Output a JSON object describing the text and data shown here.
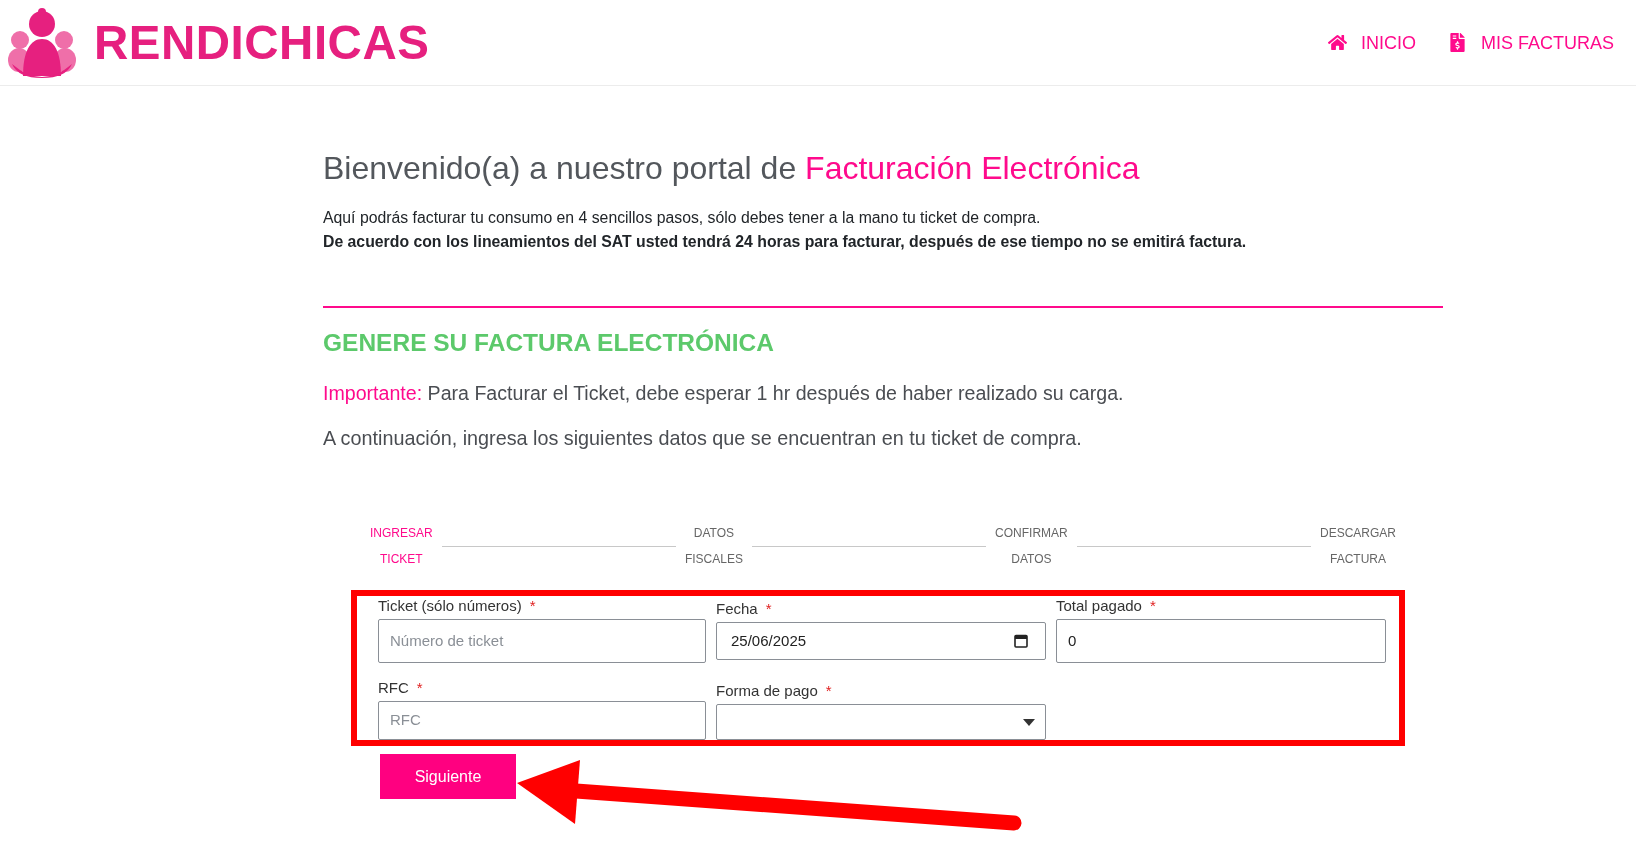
{
  "header": {
    "brand": "RENDICHICAS",
    "nav": [
      {
        "label": "INICIO"
      },
      {
        "label": "MIS FACTURAS"
      }
    ]
  },
  "intro": {
    "title": {
      "text": "Bienvenido(a) a nuestro portal de",
      "highlight": "Facturación Electrónica"
    },
    "paragraphs": [
      {
        "text": "Aquí podrás facturar tu consumo en 4 sencillos pasos, sólo debes tener a la mano tu ticket de compra.",
        "emphasis": false
      },
      {
        "text": "De acuerdo con los lineamientos del SAT usted tendrá 24 horas para facturar, después de ese tiempo no se emitirá factura.",
        "emphasis": true
      }
    ]
  },
  "section": {
    "heading": "GENERE SU FACTURA ELECTRÓNICA",
    "notice": {
      "label": "Importante:",
      "text": "Para Facturar el Ticket, debe esperar 1 hr después de haber realizado su carga."
    },
    "instruction": "A continuación, ingresa los siguientes datos que se encuentran en tu ticket de compra."
  },
  "steps": [
    {
      "label": "INGRESAR TICKET",
      "selected": true
    },
    {
      "label": "DATOS FISCALES",
      "selected": false
    },
    {
      "label": "CONFIRMAR DATOS",
      "selected": false
    },
    {
      "label": "DESCARGAR FACTURA",
      "selected": false
    }
  ],
  "form": {
    "fields": [
      {
        "kind": "text",
        "label": "Ticket (sólo números)",
        "required_mark": "*",
        "placeholder": "Número de ticket"
      },
      {
        "kind": "date",
        "label": "Fecha",
        "required_mark": "*",
        "value": "25/06/2025"
      },
      {
        "kind": "text",
        "label": "Total pagado",
        "required_mark": "*",
        "value": "0"
      },
      {
        "kind": "text",
        "label": "RFC",
        "required_mark": "*",
        "placeholder": "RFC"
      },
      {
        "kind": "select",
        "label": "Forma de pago",
        "required_mark": "*"
      }
    ],
    "submit": "Siguiente"
  },
  "annotations": {
    "highlight_frame": true,
    "pointer_arrow": true
  }
}
